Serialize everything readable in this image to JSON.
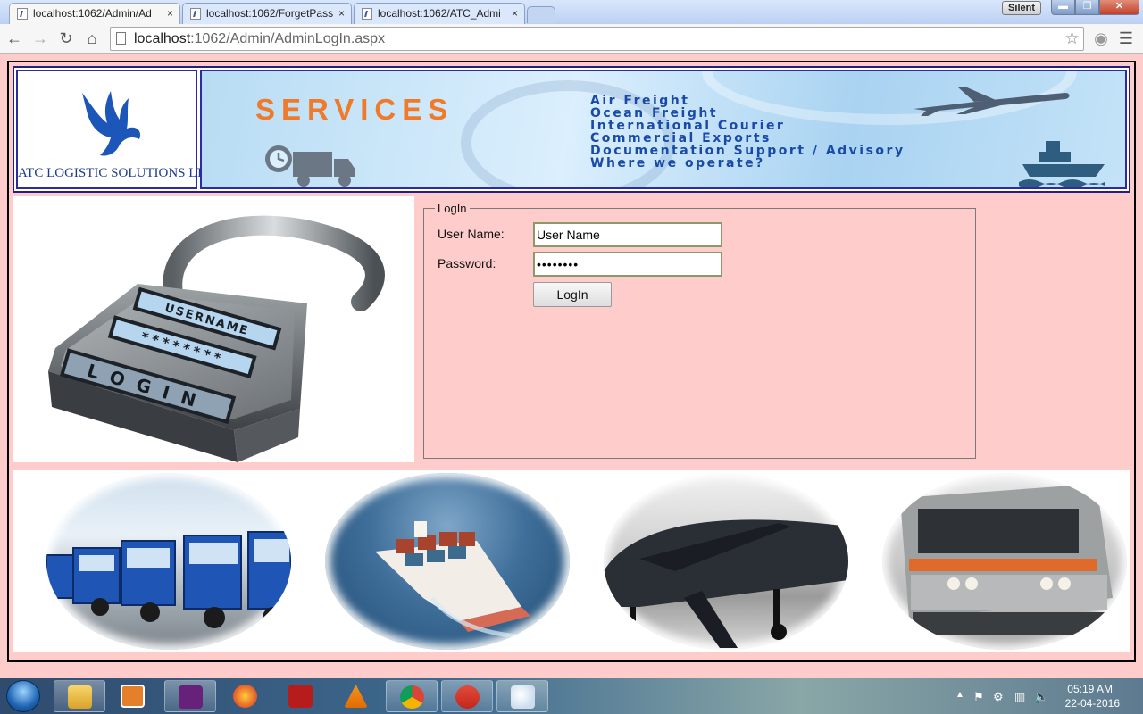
{
  "browser": {
    "tabs": [
      {
        "title": "localhost:1062/Admin/Ad",
        "active": true
      },
      {
        "title": "localhost:1062/ForgetPass",
        "active": false
      },
      {
        "title": "localhost:1062/ATC_Admi",
        "active": false
      }
    ],
    "close_glyph": "×",
    "silent_label": "Silent",
    "url_host": "localhost",
    "url_path": ":1062/Admin/AdminLogIn.aspx",
    "nav_icons": {
      "back": "arrow-left-icon",
      "forward": "arrow-right-icon",
      "reload": "reload-icon",
      "home": "home-icon",
      "bookmark": "star-icon"
    }
  },
  "header": {
    "logo_text": "ATC LOGISTIC SOLUTIONS LTD.,",
    "banner_title": "SERVICES",
    "services": [
      "Air Freight",
      "Ocean Freight",
      "International Courier",
      "Commercial Exports",
      "Documentation Support / Advisory",
      "Where we operate?"
    ]
  },
  "login_image": {
    "field_username": "USERNAME",
    "field_password": "********",
    "lock_word": "LOGIN"
  },
  "login_form": {
    "legend": "LogIn",
    "username_label": "User Name:",
    "username_value": "User Name",
    "password_label": "Password:",
    "password_value": "••••••••",
    "submit_label": "LogIn"
  },
  "transport_images": [
    "trucks",
    "cargo-ship",
    "airplane",
    "train"
  ],
  "taskbar": {
    "time": "05:19 AM",
    "date": "22-04-2016",
    "apps": [
      "file-explorer",
      "media-player",
      "visual-studio",
      "firefox",
      "acrobat-reader",
      "vlc",
      "chrome",
      "ccleaner",
      "paint"
    ]
  },
  "colors": {
    "page_background": "#ffcccc",
    "banner_accent": "#ef7b2a",
    "service_text": "#1a4aa8"
  }
}
